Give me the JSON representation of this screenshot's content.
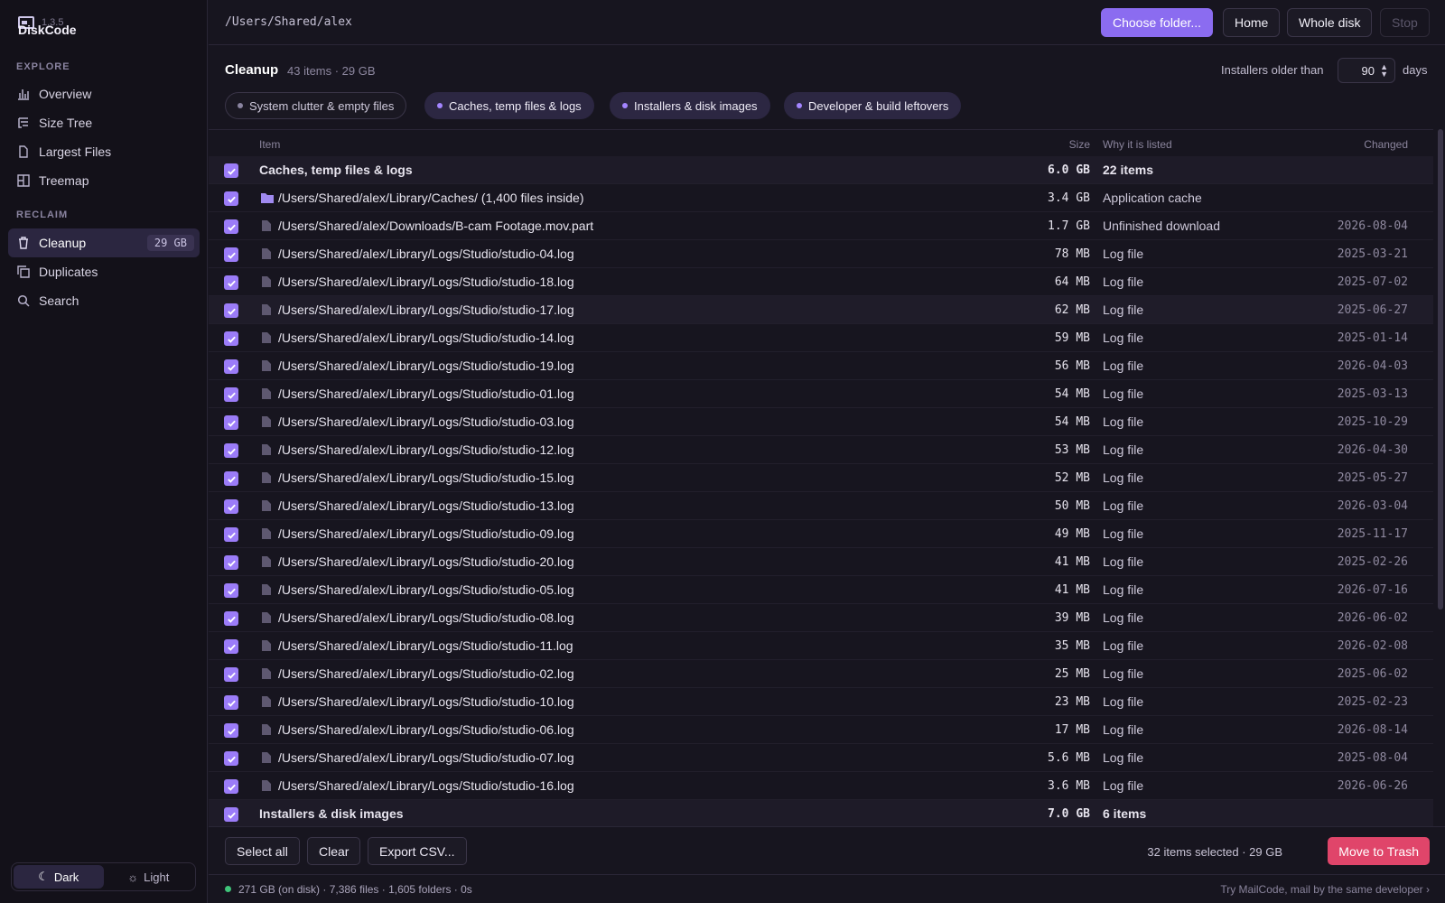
{
  "app": {
    "name": "DiskCode",
    "version": "1.3.5"
  },
  "sidebar": {
    "explore_label": "EXPLORE",
    "explore": [
      {
        "label": "Overview",
        "icon": "bar-chart-icon"
      },
      {
        "label": "Size Tree",
        "icon": "tree-icon"
      },
      {
        "label": "Largest Files",
        "icon": "file-icon"
      },
      {
        "label": "Treemap",
        "icon": "grid-icon"
      }
    ],
    "reclaim_label": "RECLAIM",
    "reclaim": [
      {
        "label": "Cleanup",
        "icon": "trash-icon",
        "badge": "29 GB",
        "active": true
      },
      {
        "label": "Duplicates",
        "icon": "copy-icon"
      },
      {
        "label": "Search",
        "icon": "search-icon"
      }
    ],
    "theme": {
      "dark": "Dark",
      "light": "Light",
      "selected": "Dark"
    }
  },
  "topbar": {
    "path": "/Users/Shared/alex",
    "choose": "Choose folder...",
    "home": "Home",
    "whole": "Whole disk",
    "stop": "Stop"
  },
  "header": {
    "title": "Cleanup",
    "summary": "43 items · 29 GB",
    "installers_label": "Installers older than",
    "installers_days": "90",
    "days_unit": "days"
  },
  "filters": [
    {
      "label": "System clutter & empty files",
      "selected": false
    },
    {
      "label": "Caches, temp files & logs",
      "selected": true
    },
    {
      "label": "Installers & disk images",
      "selected": true
    },
    {
      "label": "Developer & build leftovers",
      "selected": true
    }
  ],
  "table": {
    "columns": {
      "item": "Item",
      "size": "Size",
      "why": "Why it is listed",
      "changed": "Changed"
    },
    "rows": [
      {
        "type": "group",
        "name": "Caches, temp files & logs",
        "size": "6.0 GB",
        "why": "22 items",
        "changed": ""
      },
      {
        "type": "folder",
        "name": "/Users/Shared/alex/Library/Caches/ (1,400 files inside)",
        "size": "3.4 GB",
        "why": "Application cache",
        "changed": ""
      },
      {
        "type": "file",
        "name": "/Users/Shared/alex/Downloads/B-cam Footage.mov.part",
        "size": "1.7 GB",
        "why": "Unfinished download",
        "changed": "2026-08-04"
      },
      {
        "type": "file",
        "name": "/Users/Shared/alex/Library/Logs/Studio/studio-04.log",
        "size": "78 MB",
        "why": "Log file",
        "changed": "2025-03-21"
      },
      {
        "type": "file",
        "name": "/Users/Shared/alex/Library/Logs/Studio/studio-18.log",
        "size": "64 MB",
        "why": "Log file",
        "changed": "2025-07-02"
      },
      {
        "type": "file",
        "name": "/Users/Shared/alex/Library/Logs/Studio/studio-17.log",
        "size": "62 MB",
        "why": "Log file",
        "changed": "2025-06-27",
        "hover": true
      },
      {
        "type": "file",
        "name": "/Users/Shared/alex/Library/Logs/Studio/studio-14.log",
        "size": "59 MB",
        "why": "Log file",
        "changed": "2025-01-14"
      },
      {
        "type": "file",
        "name": "/Users/Shared/alex/Library/Logs/Studio/studio-19.log",
        "size": "56 MB",
        "why": "Log file",
        "changed": "2026-04-03"
      },
      {
        "type": "file",
        "name": "/Users/Shared/alex/Library/Logs/Studio/studio-01.log",
        "size": "54 MB",
        "why": "Log file",
        "changed": "2025-03-13"
      },
      {
        "type": "file",
        "name": "/Users/Shared/alex/Library/Logs/Studio/studio-03.log",
        "size": "54 MB",
        "why": "Log file",
        "changed": "2025-10-29"
      },
      {
        "type": "file",
        "name": "/Users/Shared/alex/Library/Logs/Studio/studio-12.log",
        "size": "53 MB",
        "why": "Log file",
        "changed": "2026-04-30"
      },
      {
        "type": "file",
        "name": "/Users/Shared/alex/Library/Logs/Studio/studio-15.log",
        "size": "52 MB",
        "why": "Log file",
        "changed": "2025-05-27"
      },
      {
        "type": "file",
        "name": "/Users/Shared/alex/Library/Logs/Studio/studio-13.log",
        "size": "50 MB",
        "why": "Log file",
        "changed": "2026-03-04"
      },
      {
        "type": "file",
        "name": "/Users/Shared/alex/Library/Logs/Studio/studio-09.log",
        "size": "49 MB",
        "why": "Log file",
        "changed": "2025-11-17"
      },
      {
        "type": "file",
        "name": "/Users/Shared/alex/Library/Logs/Studio/studio-20.log",
        "size": "41 MB",
        "why": "Log file",
        "changed": "2025-02-26"
      },
      {
        "type": "file",
        "name": "/Users/Shared/alex/Library/Logs/Studio/studio-05.log",
        "size": "41 MB",
        "why": "Log file",
        "changed": "2026-07-16"
      },
      {
        "type": "file",
        "name": "/Users/Shared/alex/Library/Logs/Studio/studio-08.log",
        "size": "39 MB",
        "why": "Log file",
        "changed": "2026-06-02"
      },
      {
        "type": "file",
        "name": "/Users/Shared/alex/Library/Logs/Studio/studio-11.log",
        "size": "35 MB",
        "why": "Log file",
        "changed": "2026-02-08"
      },
      {
        "type": "file",
        "name": "/Users/Shared/alex/Library/Logs/Studio/studio-02.log",
        "size": "25 MB",
        "why": "Log file",
        "changed": "2025-06-02"
      },
      {
        "type": "file",
        "name": "/Users/Shared/alex/Library/Logs/Studio/studio-10.log",
        "size": "23 MB",
        "why": "Log file",
        "changed": "2025-02-23"
      },
      {
        "type": "file",
        "name": "/Users/Shared/alex/Library/Logs/Studio/studio-06.log",
        "size": "17 MB",
        "why": "Log file",
        "changed": "2026-08-14"
      },
      {
        "type": "file",
        "name": "/Users/Shared/alex/Library/Logs/Studio/studio-07.log",
        "size": "5.6 MB",
        "why": "Log file",
        "changed": "2025-08-04"
      },
      {
        "type": "file",
        "name": "/Users/Shared/alex/Library/Logs/Studio/studio-16.log",
        "size": "3.6 MB",
        "why": "Log file",
        "changed": "2026-06-26"
      },
      {
        "type": "group",
        "name": "Installers & disk images",
        "size": "7.0 GB",
        "why": "6 items",
        "changed": ""
      }
    ]
  },
  "footer": {
    "select_all": "Select all",
    "clear": "Clear",
    "export": "Export CSV...",
    "selection": "32 items selected · 29 GB",
    "trash": "Move to Trash"
  },
  "status": {
    "text": "271 GB (on disk) · 7,386 files · 1,605 folders · 0s",
    "promo": "Try MailCode, mail by the same developer ›"
  },
  "colors": {
    "accent": "#8b6cf0",
    "danger": "#e0456a",
    "ok": "#3fc47a"
  }
}
